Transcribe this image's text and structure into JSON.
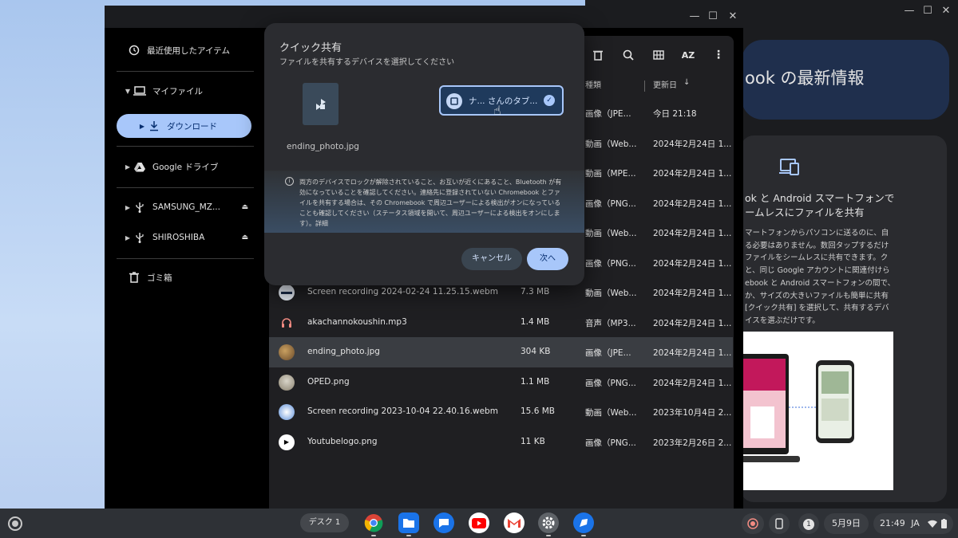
{
  "files_window": {
    "window_controls": {
      "minimize": "—",
      "maximize": "☐",
      "close": "✕"
    },
    "sidebar": {
      "recent": "最近使用したアイテム",
      "my_files": "マイファイル",
      "downloads": "ダウンロード",
      "google_drive": "Google ドライブ",
      "usb1": "SAMSUNG_MZ...",
      "usb2": "SHIROSHIBA",
      "trash": "ゴミ箱"
    },
    "toolbar": {
      "sort_label": "AZ"
    },
    "columns": {
      "type": "種類",
      "modified": "更新日",
      "sort_arrow": "↓"
    },
    "rows": [
      {
        "name": "",
        "size": "",
        "type": "画像（JPE...",
        "date": "今日 21:18"
      },
      {
        "name": "",
        "size": "",
        "type": "動画（Web...",
        "date": "2024年2月24日 1..."
      },
      {
        "name": "",
        "size": "",
        "type": "動画（MPE...",
        "date": "2024年2月24日 1..."
      },
      {
        "name": "",
        "size": "",
        "type": "画像（PNG...",
        "date": "2024年2月24日 1..."
      },
      {
        "name": "",
        "size": "",
        "type": "動画（Web...",
        "date": "2024年2月24日 1..."
      },
      {
        "name": "",
        "size": "",
        "type": "画像（PNG...",
        "date": "2024年2月24日 1..."
      },
      {
        "name": "Screen recording 2024-02-24 11.25.15.webm",
        "size": "7.3 MB",
        "type": "動画（Web...",
        "date": "2024年2月24日 1..."
      },
      {
        "name": "akachannokoushin.mp3",
        "size": "1.4 MB",
        "type": "音声（MP3...",
        "date": "2024年2月24日 1..."
      },
      {
        "name": "ending_photo.jpg",
        "size": "304 KB",
        "type": "画像（JPE...",
        "date": "2024年2月24日 1..."
      },
      {
        "name": "OPED.png",
        "size": "1.1 MB",
        "type": "画像（PNG...",
        "date": "2024年2月24日 1..."
      },
      {
        "name": "Screen recording 2023-10-04 22.40.16.webm",
        "size": "15.6 MB",
        "type": "動画（Web...",
        "date": "2023年10月4日 2..."
      },
      {
        "name": "Youtubelogo.png",
        "size": "11 KB",
        "type": "画像（PNG...",
        "date": "2023年2月26日 2..."
      }
    ]
  },
  "explore_window": {
    "window_controls": {
      "minimize": "—",
      "maximize": "☐",
      "close": "✕"
    },
    "header_title": "ook の最新情報",
    "card_title": "ok と Android スマートフォンで\nームレスにファイルを共有",
    "card_body": "マートフォンからパソコンに送るのに、自\nる必要はありません。数回タップするだけ\nファイルをシームレスに共有できます。ク\nと、同じ Google アカウントに関連付けら\nebook と Android スマートフォンの間で、\nか、サイズの大きいファイルも簡単に共有\n[クイック共有] を選択して、共有するデバ\nイスを選ぶだけです。"
  },
  "dialog": {
    "title": "クイック共有",
    "subtitle": "ファイルを共有するデバイスを選択してください",
    "file_name": "ending_photo.jpg",
    "device_label": "ナ... さんのタブ...",
    "info_text": "両方のデバイスでロックが解除されていること、お互いが近くにあること、Bluetooth が有効になっていることを確認してください。連絡先に登録されていない Chromebook とファイルを共有する場合は、その Chromebook で周辺ユーザーによる検出がオンになっていることも確認してください（ステータス領域を開いて、周辺ユーザーによる検出をオンにします）。",
    "info_link": "詳細",
    "cancel": "キャンセル",
    "next": "次へ"
  },
  "shelf": {
    "desk": "デスク 1",
    "date": "5月9日",
    "time": "21:49",
    "ime": "JA",
    "notification_count": "1"
  },
  "colors": {
    "accent": "#a8c7fa",
    "accent_text": "#062e6f",
    "window_bg": "#1b1c1f",
    "shelf_bg": "#2e3136"
  }
}
